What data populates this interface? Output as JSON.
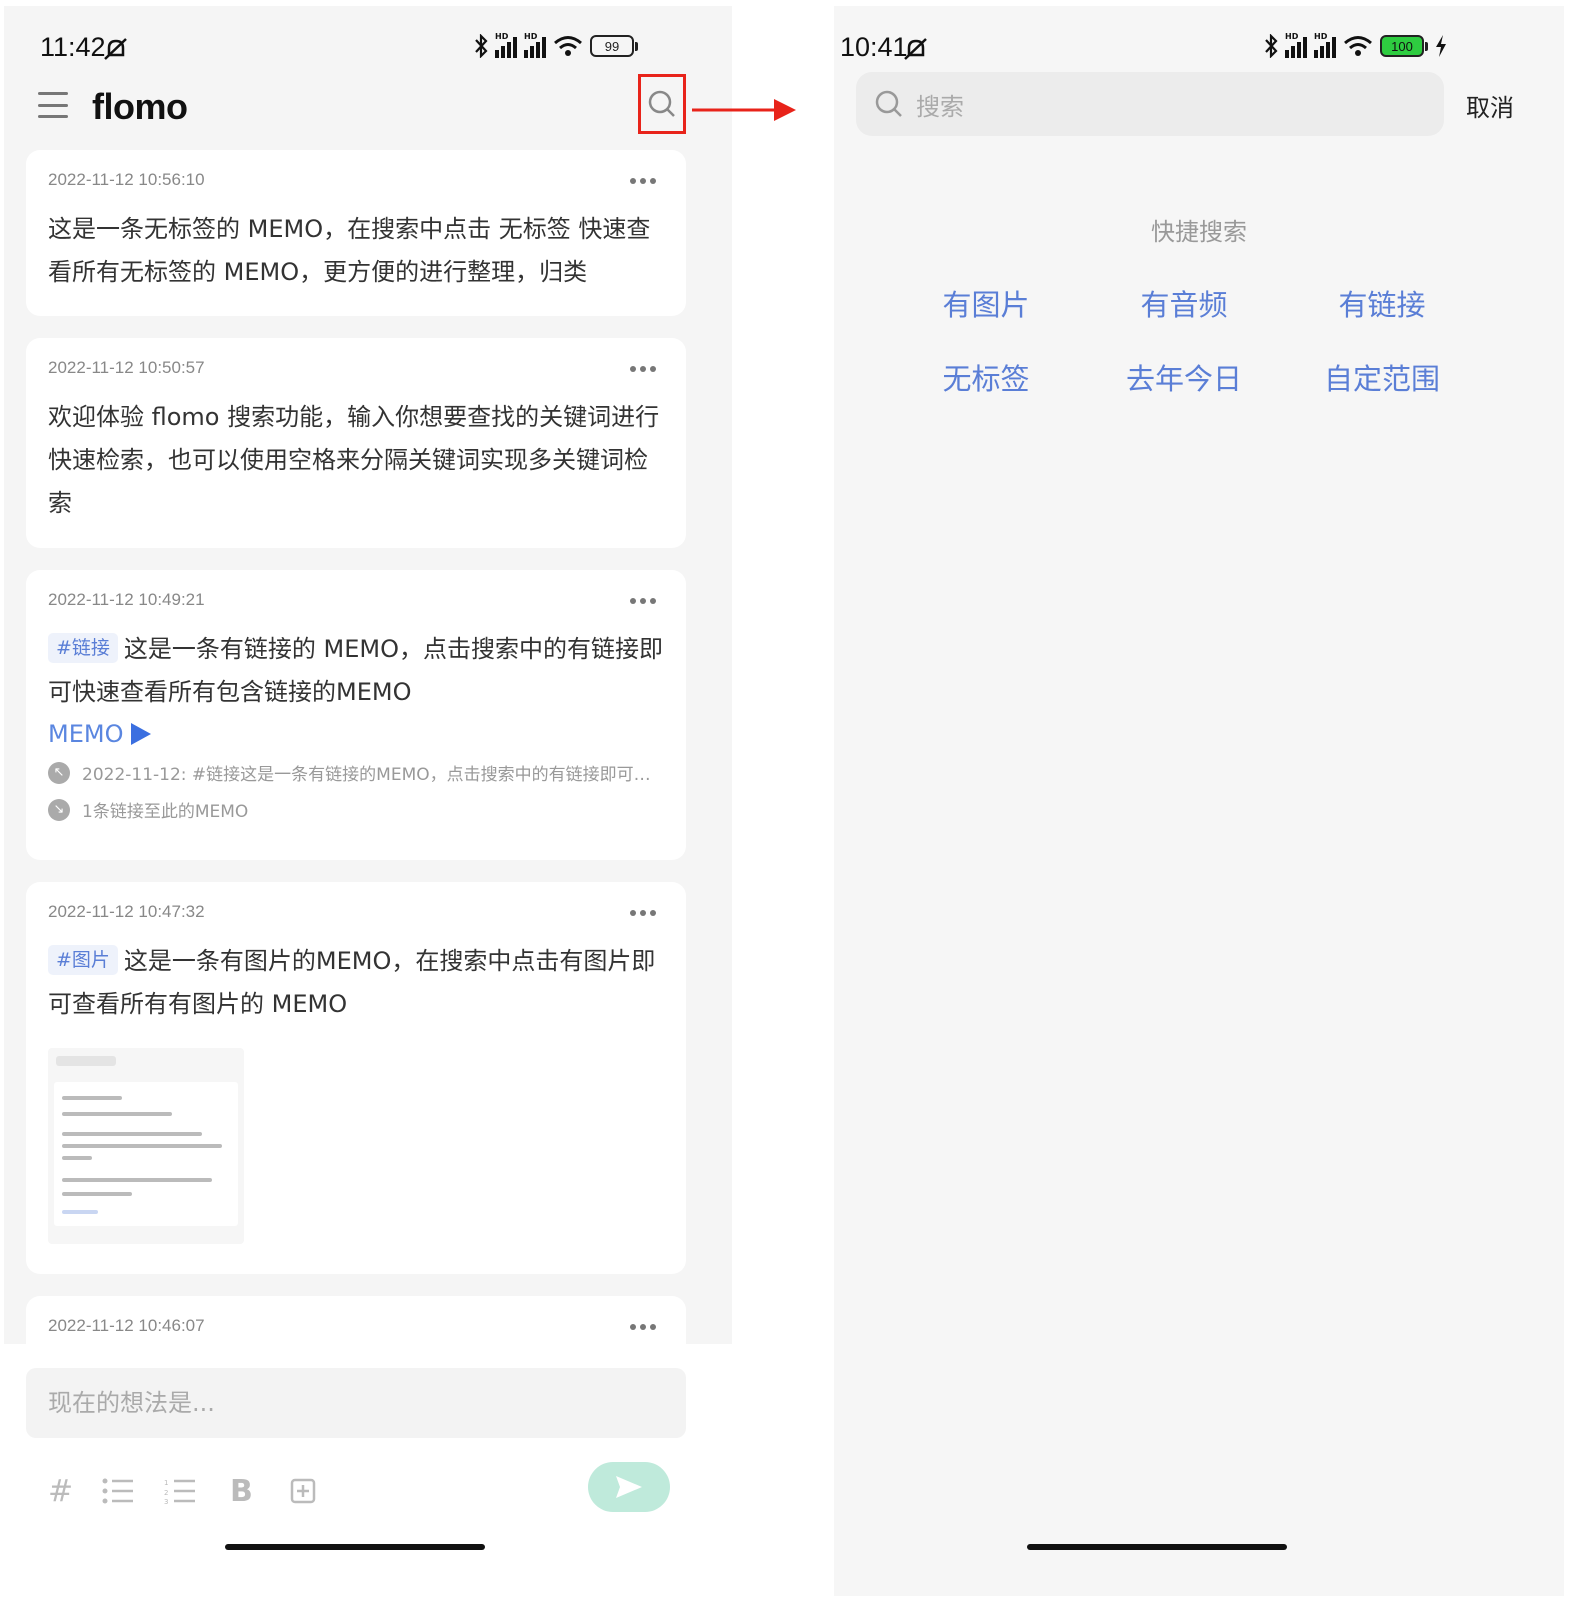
{
  "left": {
    "status": {
      "time": "11:42",
      "battery": "99"
    },
    "app_title": "flomo",
    "memos": [
      {
        "time": "2022-11-12 10:56:10",
        "text": "这是一条无标签的 MEMO，在搜索中点击 无标签 快速查看所有无标签的 MEMO，更方便的进行整理，归类"
      },
      {
        "time": "2022-11-12 10:50:57",
        "text": "欢迎体验 flomo 搜索功能，输入你想要查找的关键词进行快速检索，也可以使用空格来分隔关键词实现多关键词检索"
      },
      {
        "time": "2022-11-12 10:49:21",
        "tag": "#链接",
        "text": "这是一条有链接的 MEMO，点击搜索中的有链接即可快速查看所有包含链接的MEMO",
        "link_label": "MEMO",
        "ref_out": "2022-11-12: #链接这是一条有链接的MEMO，点击搜索中的有链接即可…",
        "ref_in": "1条链接至此的MEMO"
      },
      {
        "time": "2022-11-12 10:47:32",
        "tag": "#图片",
        "text": "这是一条有图片的MEMO，在搜索中点击有图片即可查看所有有图片的 MEMO"
      },
      {
        "time": "2022-11-12 10:46:07"
      }
    ],
    "composer": {
      "placeholder": "现在的想法是...",
      "tools": {
        "hash": "#",
        "bold": "B"
      }
    }
  },
  "right": {
    "status": {
      "time": "10:41",
      "battery": "100"
    },
    "search_placeholder": "搜索",
    "cancel_label": "取消",
    "quick_search_title": "快捷搜索",
    "quick_items": [
      "有图片",
      "有音频",
      "有链接",
      "无标签",
      "去年今日",
      "自定范围"
    ]
  },
  "colors": {
    "accent_blue": "#5a7ed6",
    "highlight_red": "#e8231a",
    "send_green": "#bfeadb"
  }
}
